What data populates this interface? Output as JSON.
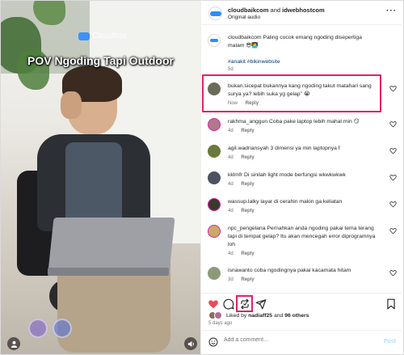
{
  "video": {
    "brand": "Cloudbox",
    "overlay_title": "POV Ngoding Tapi Outdoor"
  },
  "header": {
    "user1": "cloudbaikcom",
    "and": "and",
    "user2": "idwebhostcom",
    "audio": "Original audio",
    "more": "···"
  },
  "caption": {
    "text": "cloudbaikcom Paling cocok emang ngoding disepertiga malam 😎🧑‍💻",
    "hashtags": "#anakit #bikinwebsite",
    "time": "5d"
  },
  "comments": [
    {
      "text": "bukan.sicepat bukannya kang ngoding takut matahari sang surya ya? lebih suka yg gelap\" 😭",
      "time": "Now",
      "reply": "Reply"
    },
    {
      "text": "rakhma_anggun Coba pake laptop lebih mahal min 😏",
      "time": "4d",
      "reply": "Reply"
    },
    {
      "text": "agil.wadriansyah 3 dimensi ya min laptopnya✌",
      "time": "4d",
      "reply": "Reply"
    },
    {
      "text": "kklmfr Di sinilah light mode berfungsi wkwkwkwk",
      "time": "4d",
      "reply": "Reply"
    },
    {
      "text": "wassup.lalky layar di cerahin makin ga keliatan",
      "time": "4d",
      "reply": "Reply"
    },
    {
      "text": "npc_pengelana Pernahkan anda ngoding pakai tema terang tapi di tempat gelap? Itu akan mencegah error diprogramnya loh",
      "time": "4d",
      "reply": "Reply"
    },
    {
      "text": "isnawanto coba ngodingnya pakai kacamata hitam",
      "time": "3d",
      "reply": "Reply"
    }
  ],
  "likes": {
    "prefix": "Liked by",
    "user": "nadiaff25",
    "and": "and",
    "others": "96 others",
    "ago": "5 days ago"
  },
  "composer": {
    "placeholder": "Add a comment…",
    "post": "Post"
  },
  "colors": {
    "heart_active": "#ed4956",
    "highlight": "#e0245e",
    "link": "#00376b"
  }
}
